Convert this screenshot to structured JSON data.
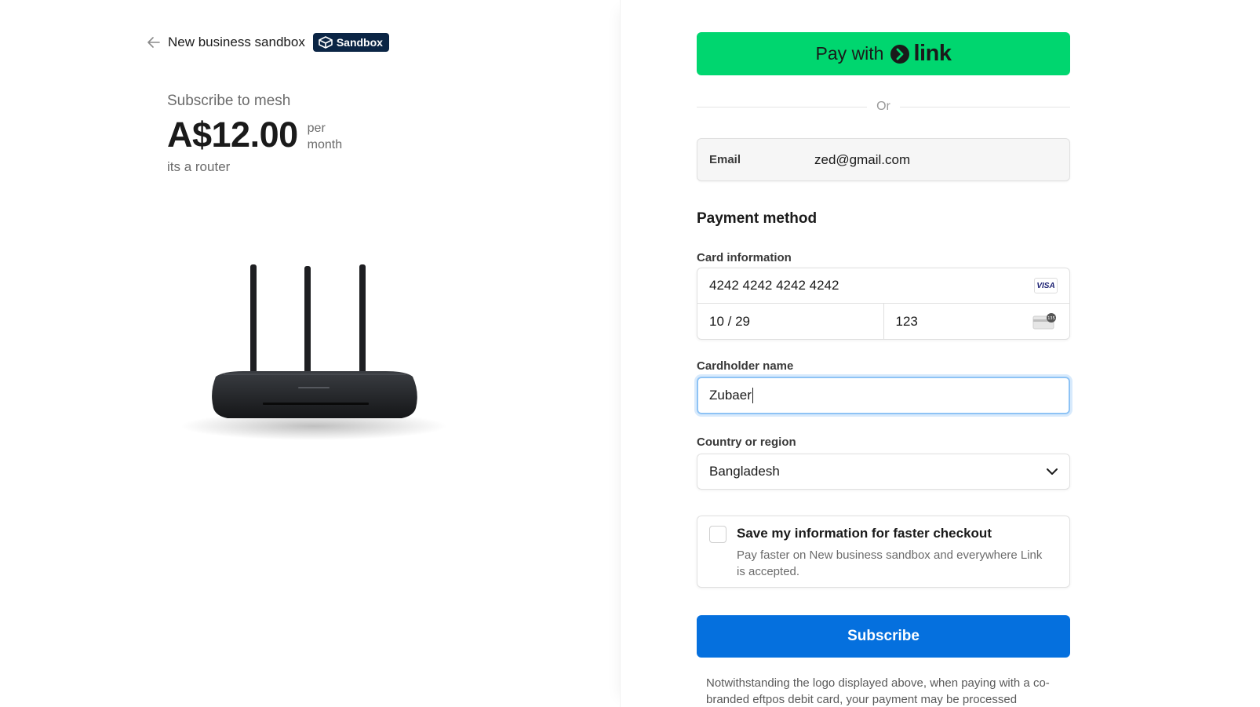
{
  "header": {
    "merchant_name": "New business sandbox",
    "badge_label": "Sandbox"
  },
  "product": {
    "title": "Subscribe to mesh",
    "price": "A$12.00",
    "period_line1": "per",
    "period_line2": "month",
    "description": "its a router"
  },
  "checkout": {
    "link_button_prefix": "Pay with",
    "link_button_brand": "link",
    "or_divider": "Or",
    "email_label": "Email",
    "email_value": "zed@gmail.com",
    "payment_method_title": "Payment method",
    "card_info_label": "Card information",
    "card_number": "4242 4242 4242 4242",
    "card_brand": "VISA",
    "card_expiry": "10 / 29",
    "card_cvc": "123",
    "cardholder_label": "Cardholder name",
    "cardholder_value": "Zubaer",
    "country_label": "Country or region",
    "country_value": "Bangladesh",
    "save_title": "Save my information for faster checkout",
    "save_desc": "Pay faster on New business sandbox and everywhere Link is accepted.",
    "subscribe_label": "Subscribe",
    "disclaimer": "Notwithstanding the logo displayed above, when paying with a co-branded eftpos debit card, your payment may be processed"
  },
  "colors": {
    "link_green": "#00d66f",
    "subscribe_blue": "#0570de",
    "badge_navy": "#0b2545",
    "focus_ring": "#8ec3f5"
  },
  "icons": {
    "back": "arrow-left-icon",
    "badge": "sandbox-box-icon",
    "link_logo": "link-chevron-icon",
    "card_brand": "visa-icon",
    "cvc": "cvc-card-icon",
    "select": "chevron-down-icon"
  }
}
